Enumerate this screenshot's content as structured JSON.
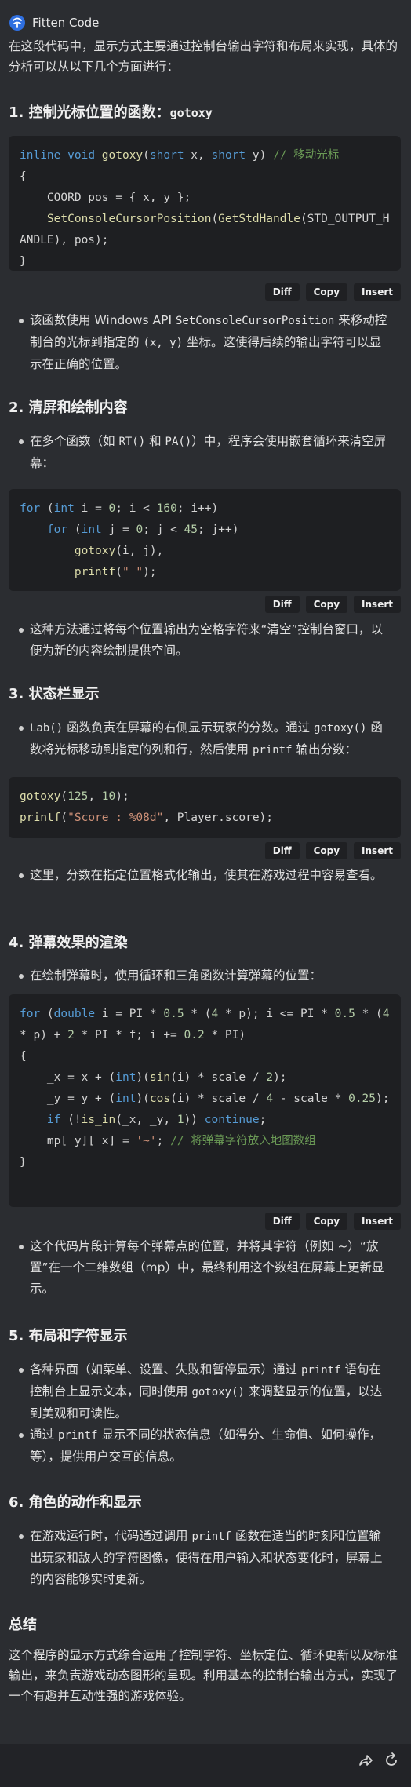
{
  "header": {
    "app_name": "Fitten Code"
  },
  "intro": "在这段代码中，显示方式主要通过控制台输出字符和布局来实现，具体的分析可以从以下几个方面进行：",
  "s1": {
    "title": "1. 控制光标位置的函数：",
    "title_code": "gotoxy",
    "bullet_parts": [
      "该函数使用 Windows API ",
      "SetConsoleCursorPosition",
      " 来移动控制台的光标到指定的 ",
      "(x, y)",
      " 坐标。这使得后续的输出字符可以显示在正确的位置。"
    ]
  },
  "s2": {
    "title": "2. 清屏和绘制内容",
    "bullet_parts": [
      "在多个函数（如 ",
      "RT()",
      " 和 ",
      "PA()",
      "）中，程序会使用嵌套循环来清空屏幕："
    ],
    "bullet2": "这种方法通过将每个位置输出为空格字符来“清空”控制台窗口，以便为新的内容绘制提供空间。"
  },
  "s3": {
    "title": "3. 状态栏显示",
    "bullet_parts": [
      "Lab()",
      " 函数负责在屏幕的右侧显示玩家的分数。通过 ",
      "gotoxy()",
      " 函数将光标移动到指定的列和行，然后使用 ",
      "printf",
      " 输出分数："
    ],
    "bullet2": "这里，分数在指定位置格式化输出，使其在游戏过程中容易查看。"
  },
  "s4": {
    "title": "4. 弹幕效果的渲染",
    "bullet": "在绘制弹幕时，使用循环和三角函数计算弹幕的位置：",
    "bullet2": "这个代码片段计算每个弹幕点的位置，并将其字符（例如 ~）“放置”在一个二维数组（mp）中，最终利用这个数组在屏幕上更新显示。"
  },
  "s5": {
    "title": "5. 布局和字符显示",
    "b1_parts": [
      "各种界面（如菜单、设置、失败和暂停显示）通过 ",
      "printf",
      " 语句在控制台上显示文本，同时使用 ",
      "gotoxy()",
      " 来调整显示的位置，以达到美观和可读性。"
    ],
    "b2_parts": [
      "通过 ",
      "printf",
      " 显示不同的状态信息（如得分、生命值、如何操作，等），提供用户交互的信息。"
    ]
  },
  "s6": {
    "title": "6. 角色的动作和显示",
    "b1_parts": [
      "在游戏运行时，代码通过调用 ",
      "printf",
      " 函数在适当的时刻和位置输出玩家和敌人的字符图像，使得在用户输入和状态变化时，屏幕上的内容能够实时更新。"
    ]
  },
  "summary": {
    "title": "总结",
    "text": "这个程序的显示方式综合运用了控制字符、坐标定位、循环更新以及标准输出，来负责游戏动态图形的呈现。利用基本的控制台输出方式，实现了一个有趣并互动性强的游戏体验。"
  },
  "actions": {
    "diff": "Diff",
    "copy": "Copy",
    "insert": "Insert"
  },
  "icons": {
    "logo": "fitten-logo-icon",
    "share": "share-icon",
    "refresh": "refresh-icon"
  },
  "colors": {
    "background": "#2b2d31",
    "code_bg": "#1e1f22",
    "keyword": "#569cd6",
    "function": "#dcdcaa",
    "comment": "#6a9955",
    "string": "#ce9178"
  }
}
